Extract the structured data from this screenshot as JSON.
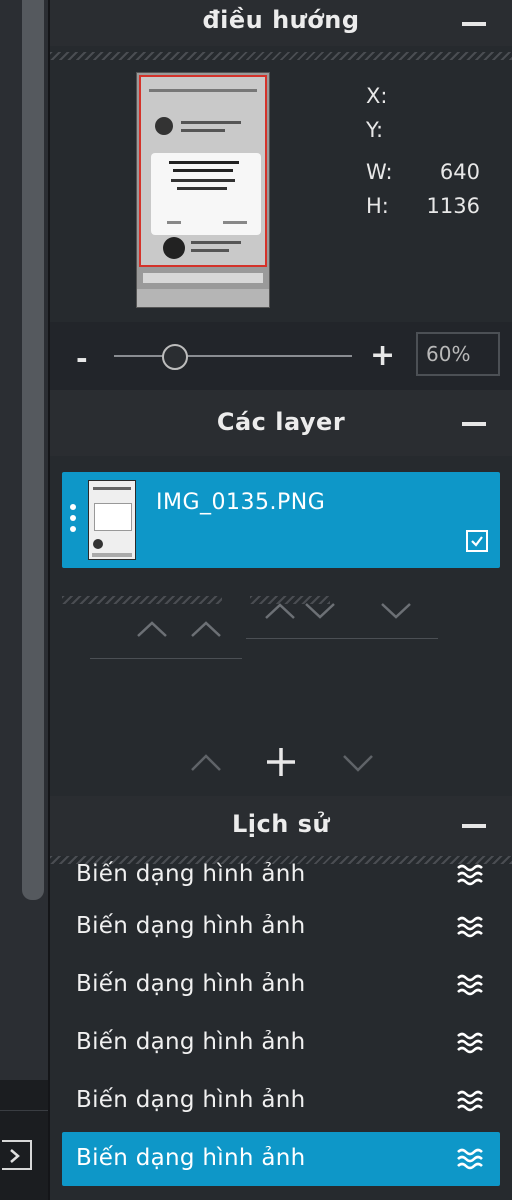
{
  "navigator": {
    "title": "điều hướng",
    "coords": [
      {
        "key": "X:",
        "value": ""
      },
      {
        "key": "Y:",
        "value": ""
      },
      {
        "key": "W:",
        "value": "640"
      },
      {
        "key": "H:",
        "value": "1136"
      }
    ],
    "zoom": {
      "minus": "-",
      "plus": "+",
      "value": "60%",
      "slider_level": 0.25
    }
  },
  "layers": {
    "title": "Các layer",
    "items": [
      {
        "name": "IMG_0135.PNG",
        "visible": true
      }
    ]
  },
  "history": {
    "title": "Lịch sử",
    "items": [
      {
        "label": "Biến dạng hình ảnh",
        "icon": "transform-wave-icon"
      },
      {
        "label": "Biến dạng hình ảnh",
        "icon": "transform-wave-icon"
      },
      {
        "label": "Biến dạng hình ảnh",
        "icon": "transform-wave-icon"
      },
      {
        "label": "Biến dạng hình ảnh",
        "icon": "transform-wave-icon"
      },
      {
        "label": "Biến dạng hình ảnh",
        "icon": "transform-wave-icon"
      },
      {
        "label": "Biến dạng hình ảnh",
        "icon": "transform-wave-icon",
        "active": true
      }
    ]
  },
  "colors": {
    "accent": "#0e97c8",
    "panel_bg": "#262a2e",
    "header_bg": "#2a2d31"
  }
}
